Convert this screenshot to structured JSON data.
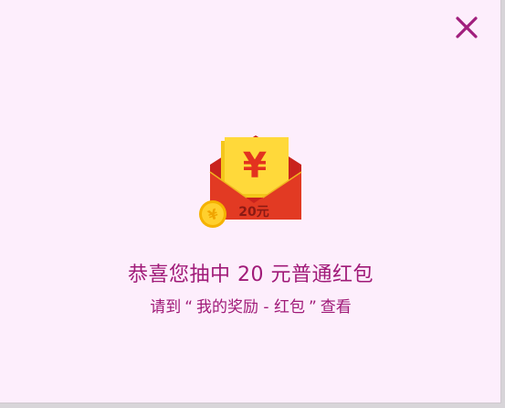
{
  "dialog": {
    "close_icon": "close-icon",
    "close_color": "#a11f7d",
    "background": "#fdeefc"
  },
  "prize": {
    "envelope_icon": "red-envelope-icon",
    "coin_icon": "gold-coin-icon",
    "currency_symbol": "¥",
    "coin_symbol": "¥",
    "amount_label": "20元"
  },
  "message": {
    "title": "恭喜您抽中 20 元普通红包",
    "subtitle_prefix": "请到",
    "quote_open": "“",
    "subtitle_target": "我的奖励 - 红包",
    "quote_close": "”",
    "subtitle_suffix": "查看",
    "text_color": "#a01a78"
  }
}
